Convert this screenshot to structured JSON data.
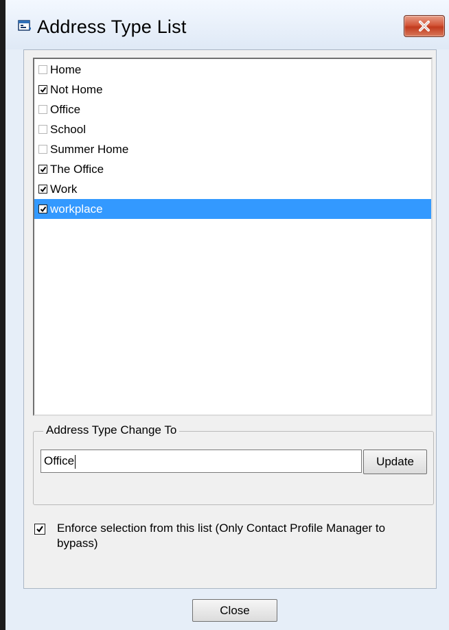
{
  "window": {
    "title": "Address Type List",
    "accent_color": "#3399ff",
    "close_button_color": "#c23b1e",
    "app_icon": "window-app-icon",
    "close_icon": "close-x-icon"
  },
  "address_types": {
    "items": [
      {
        "label": "Home",
        "checked": false,
        "selected": false
      },
      {
        "label": "Not Home",
        "checked": true,
        "selected": false
      },
      {
        "label": "Office",
        "checked": false,
        "selected": false
      },
      {
        "label": "School",
        "checked": false,
        "selected": false
      },
      {
        "label": "Summer Home",
        "checked": false,
        "selected": false
      },
      {
        "label": "The Office",
        "checked": true,
        "selected": false
      },
      {
        "label": "Work",
        "checked": true,
        "selected": false
      },
      {
        "label": "workplace",
        "checked": true,
        "selected": true
      }
    ]
  },
  "change_group": {
    "legend": "Address Type Change To",
    "input_value": "Office",
    "update_label": "Update"
  },
  "enforce": {
    "checked": true,
    "label": "Enforce selection from this list (Only Contact Profile Manager to bypass)"
  },
  "footer": {
    "close_label": "Close"
  }
}
